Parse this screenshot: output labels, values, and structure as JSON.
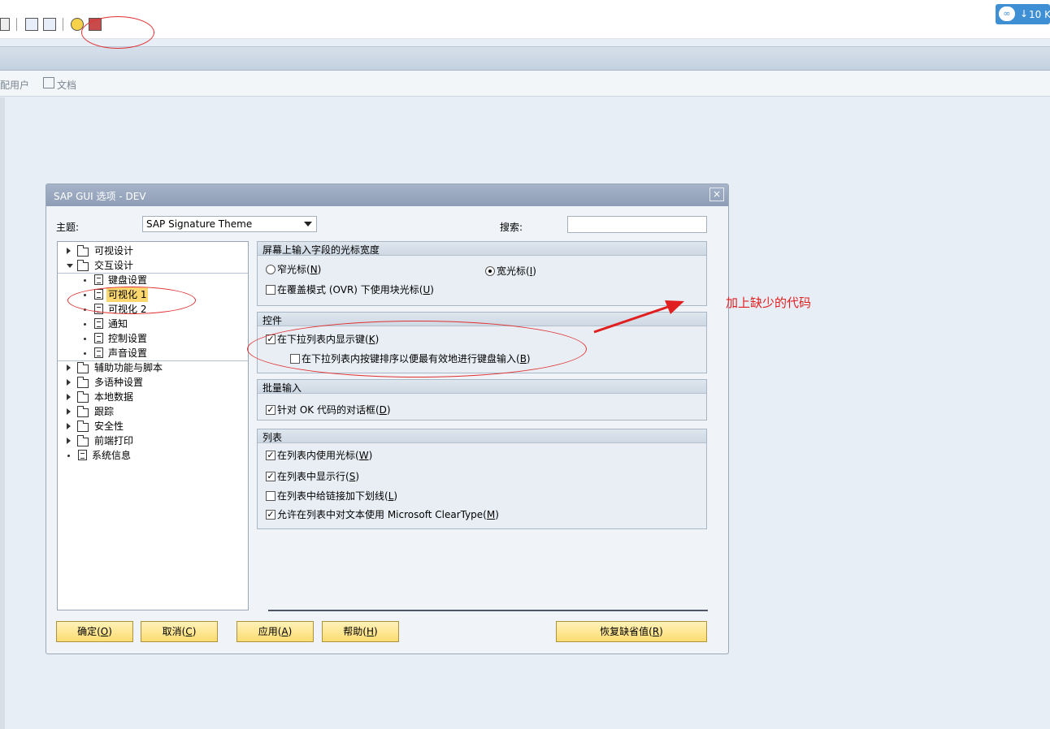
{
  "app": {
    "appbar": {
      "item1": "配用户",
      "item2": "文档"
    },
    "baidu": {
      "label": "10 K"
    }
  },
  "dialog": {
    "title": "SAP GUI 选项 - DEV",
    "close": "×",
    "theme_label": "主题:",
    "theme_value": "SAP Signature Theme",
    "search_label": "搜索:",
    "search_value": "",
    "tree": [
      {
        "label": "可视设计",
        "type": "folder",
        "state": "collapsed"
      },
      {
        "label": "交互设计",
        "type": "folder",
        "state": "expanded"
      },
      {
        "label": "键盘设置",
        "type": "doc",
        "child": true
      },
      {
        "label": "可视化 1",
        "type": "doc",
        "child": true,
        "selected": true
      },
      {
        "label": "可视化 2",
        "type": "doc",
        "child": true
      },
      {
        "label": "通知",
        "type": "doc",
        "child": true
      },
      {
        "label": "控制设置",
        "type": "doc",
        "child": true
      },
      {
        "label": "声音设置",
        "type": "doc",
        "child": true
      },
      {
        "label": "辅助功能与脚本",
        "type": "folder",
        "state": "collapsed"
      },
      {
        "label": "多语种设置",
        "type": "folder",
        "state": "collapsed"
      },
      {
        "label": "本地数据",
        "type": "folder",
        "state": "collapsed"
      },
      {
        "label": "跟踪",
        "type": "folder",
        "state": "collapsed"
      },
      {
        "label": "安全性",
        "type": "folder",
        "state": "collapsed"
      },
      {
        "label": "前端打印",
        "type": "folder",
        "state": "collapsed"
      },
      {
        "label": "系统信息",
        "type": "doc"
      }
    ],
    "groups": {
      "cursor": {
        "title": "屏幕上输入字段的光标宽度",
        "narrow": {
          "text": "窄光标(",
          "key": "N",
          "end": ")",
          "checked": false
        },
        "wide": {
          "text": "宽光标(",
          "key": "I",
          "end": ")",
          "checked": true
        },
        "block": {
          "text": "在覆盖模式 (OVR) 下使用块光标(",
          "key": "U",
          "end": ")",
          "checked": false
        }
      },
      "controls": {
        "title": "控件",
        "showkey": {
          "text": "在下拉列表内显示键(",
          "key": "K",
          "end": ")",
          "checked": true
        },
        "sortkey": {
          "text": "在下拉列表内按键排序以便最有效地进行键盘输入(",
          "key": "B",
          "end": ")",
          "checked": false
        }
      },
      "batch": {
        "title": "批量输入",
        "okdialog": {
          "text": "针对 OK 代码的对话框(",
          "key": "D",
          "end": ")",
          "checked": true
        }
      },
      "list": {
        "title": "列表",
        "cursor": {
          "text": "在列表内使用光标(",
          "key": "W",
          "end": ")",
          "checked": true
        },
        "rows": {
          "text": "在列表中显示行(",
          "key": "S",
          "end": ")",
          "checked": true
        },
        "links": {
          "text": "在列表中给链接加下划线(",
          "key": "L",
          "end": ")",
          "checked": false
        },
        "cleartype": {
          "text": "允许在列表中对文本使用 Microsoft ClearType(",
          "key": "M",
          "end": ")",
          "checked": true
        }
      }
    },
    "buttons": {
      "ok": {
        "text": "确定(",
        "key": "O",
        "end": ")"
      },
      "cancel": {
        "text": "取消(",
        "key": "C",
        "end": ")"
      },
      "apply": {
        "text": "应用(",
        "key": "A",
        "end": ")"
      },
      "help": {
        "text": "帮助(",
        "key": "H",
        "end": ")"
      },
      "restore": {
        "text": "恢复缺省值(",
        "key": "R",
        "end": ")"
      }
    }
  },
  "annotation": {
    "text": "加上缺少的代码",
    "color": "#e02020"
  }
}
